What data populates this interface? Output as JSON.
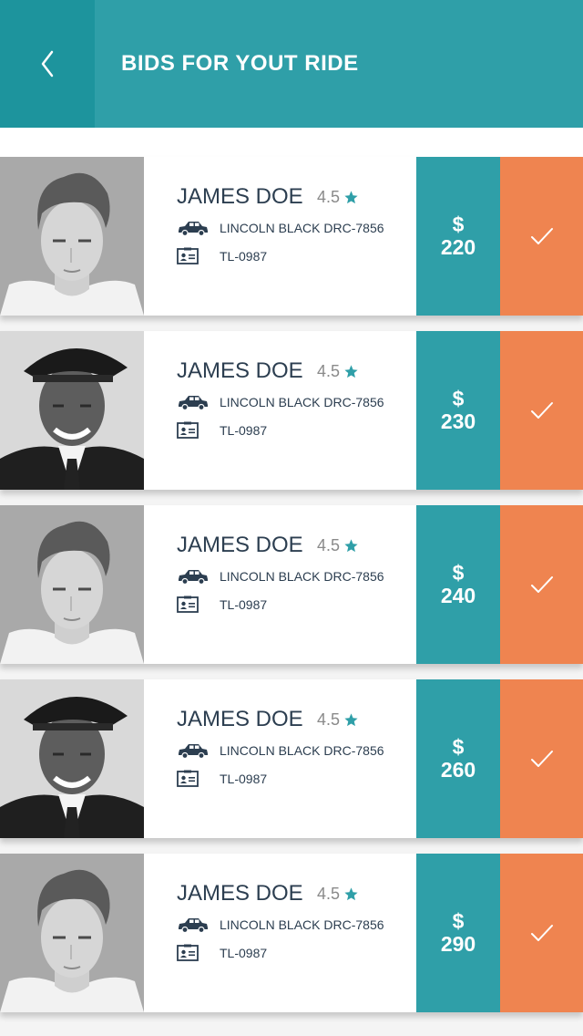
{
  "header": {
    "title": "BIDS FOR YOUT RIDE",
    "back_icon": "chevron-left-icon"
  },
  "colors": {
    "teal": "#2f9fa8",
    "teal_dark": "#1d949d",
    "orange": "#ef8450"
  },
  "bids": [
    {
      "name": "JAMES DOE",
      "rating": "4.5",
      "car": "LINCOLN BLACK DRC-7856",
      "license": "TL-0987",
      "currency": "$",
      "amount": "220",
      "photo": "young-man-photo"
    },
    {
      "name": "JAMES DOE",
      "rating": "4.5",
      "car": "LINCOLN BLACK DRC-7856",
      "license": "TL-0987",
      "currency": "$",
      "amount": "230",
      "photo": "chauffeur-photo"
    },
    {
      "name": "JAMES DOE",
      "rating": "4.5",
      "car": "LINCOLN BLACK DRC-7856",
      "license": "TL-0987",
      "currency": "$",
      "amount": "240",
      "photo": "young-man-photo"
    },
    {
      "name": "JAMES DOE",
      "rating": "4.5",
      "car": "LINCOLN BLACK DRC-7856",
      "license": "TL-0987",
      "currency": "$",
      "amount": "260",
      "photo": "chauffeur-photo"
    },
    {
      "name": "JAMES DOE",
      "rating": "4.5",
      "car": "LINCOLN BLACK DRC-7856",
      "license": "TL-0987",
      "currency": "$",
      "amount": "290",
      "photo": "young-man-photo"
    }
  ]
}
